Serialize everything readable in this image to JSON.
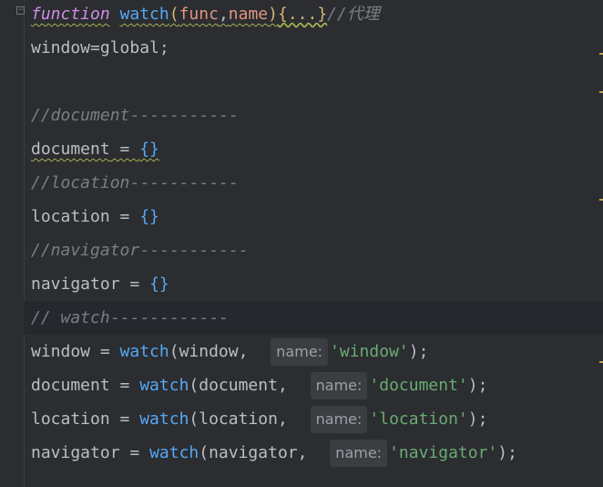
{
  "editor": {
    "lines": {
      "l1": {
        "keyword": "function",
        "fn_name": "watch",
        "open_paren": "(",
        "param1": "func",
        "comma": ",",
        "param2": "name",
        "close_paren": ")",
        "folded_body": "{...}",
        "comment": "//代理"
      },
      "l2": {
        "text": "window=global;"
      },
      "l4": {
        "comment": "//document",
        "dashes": "-----------"
      },
      "l5": {
        "target": "document",
        "op": " = ",
        "value": "{}"
      },
      "l6": {
        "comment": "//location",
        "dashes": "-----------"
      },
      "l7": {
        "target": "location",
        "op": " = ",
        "value": "{}"
      },
      "l8": {
        "comment": "//navigator",
        "dashes": "-----------"
      },
      "l9": {
        "target": "navigator",
        "op": " = ",
        "value": "{}"
      },
      "l10": {
        "comment": "// watch",
        "dashes": "------------"
      },
      "l11": {
        "target": "window",
        "op": " = ",
        "fn": "watch",
        "arg": "(window, ",
        "hint": "name:",
        "str": "'window'",
        "end": ");"
      },
      "l12": {
        "target": "document",
        "op": " = ",
        "fn": "watch",
        "arg": "(document, ",
        "hint": "name:",
        "str": "'document'",
        "end": ");"
      },
      "l13": {
        "target": "location",
        "op": " = ",
        "fn": "watch",
        "arg": "(location, ",
        "hint": "name:",
        "str": "'location'",
        "end": ");"
      },
      "l14": {
        "target": "navigator",
        "op": " = ",
        "fn": "watch",
        "arg": "(navigator, ",
        "hint": "name:",
        "str": "'navigator'",
        "end": ");"
      }
    }
  },
  "colors": {
    "background": "#2b2d30",
    "current_line": "#26282e",
    "keyword": "#cf8ee8",
    "function": "#56a8f5",
    "parameter": "#e0957f",
    "string": "#6aab73",
    "comment": "#7a7e85",
    "text": "#bcbec4"
  }
}
